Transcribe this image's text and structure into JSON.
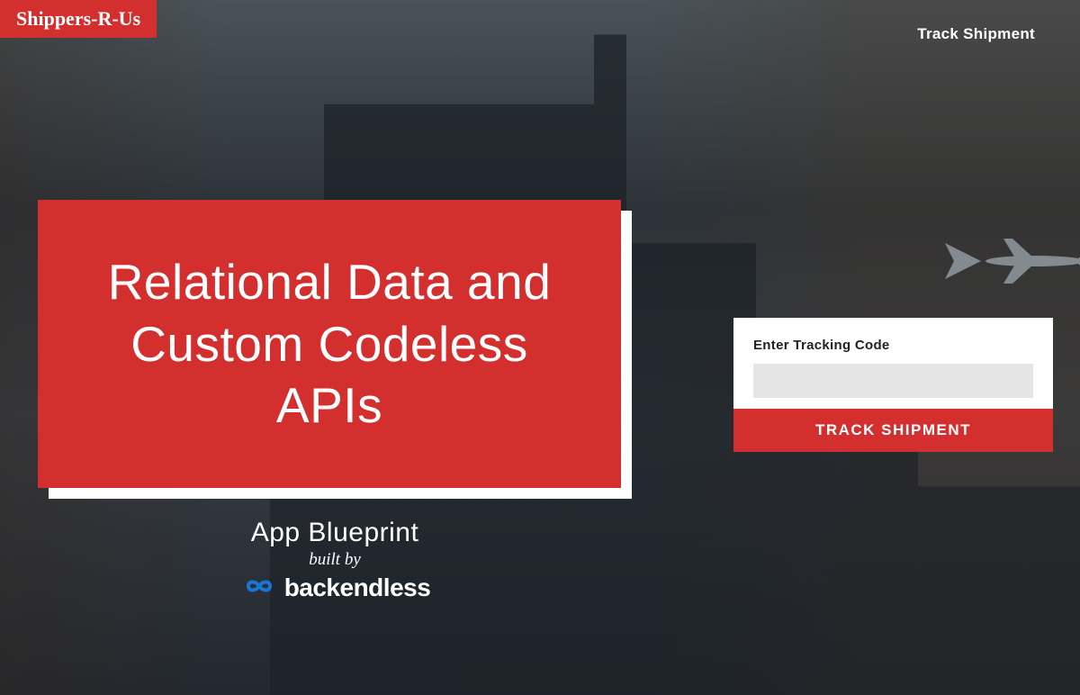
{
  "brand": {
    "logo_text": "Shippers-R-Us"
  },
  "nav": {
    "track_link": "Track Shipment"
  },
  "hero": {
    "title": "Relational Data and Custom Codeless APIs",
    "subtitle": "App Blueprint",
    "built_by": "built by",
    "builder_name": "backendless"
  },
  "tracking": {
    "label": "Enter Tracking Code",
    "button": "TRACK SHIPMENT"
  },
  "colors": {
    "accent": "#D32F2F"
  }
}
